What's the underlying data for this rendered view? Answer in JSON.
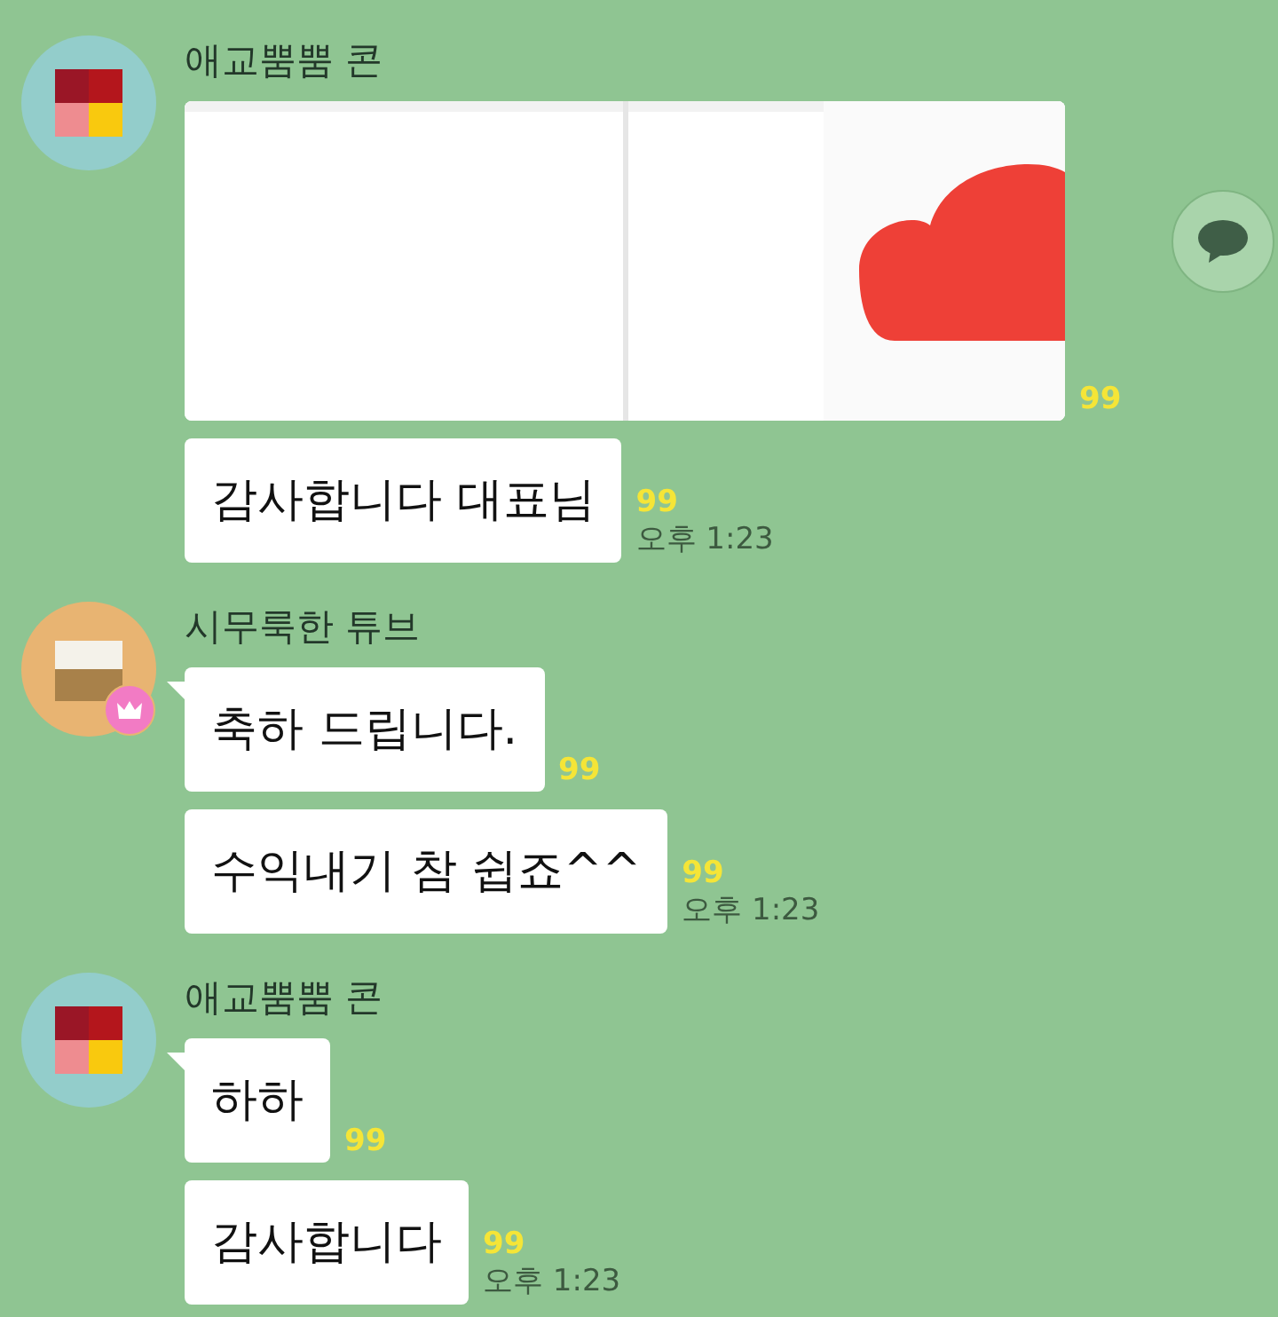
{
  "groups": [
    {
      "sender": "애교뿜뿜 콘",
      "avatar": {
        "kind": "quad"
      },
      "crown": false,
      "messages": [
        {
          "kind": "picture",
          "unread": "99",
          "share": true
        },
        {
          "kind": "text",
          "text": "감사합니다 대표님",
          "unread": "99",
          "time": "오후 1:23"
        }
      ]
    },
    {
      "sender": "시무룩한 튜브",
      "avatar": {
        "kind": "split"
      },
      "crown": true,
      "messages": [
        {
          "kind": "text",
          "text": "축하 드립니다.",
          "unread": "99"
        },
        {
          "kind": "text",
          "text": "수익내기 참 쉽죠^^",
          "unread": "99",
          "time": "오후 1:23"
        }
      ]
    },
    {
      "sender": "애교뿜뿜 콘",
      "avatar": {
        "kind": "quad"
      },
      "crown": false,
      "messages": [
        {
          "kind": "text",
          "text": "하하",
          "unread": "99"
        },
        {
          "kind": "text",
          "text": "감사합니다",
          "unread": "99",
          "time": "오후 1:23"
        }
      ]
    }
  ]
}
